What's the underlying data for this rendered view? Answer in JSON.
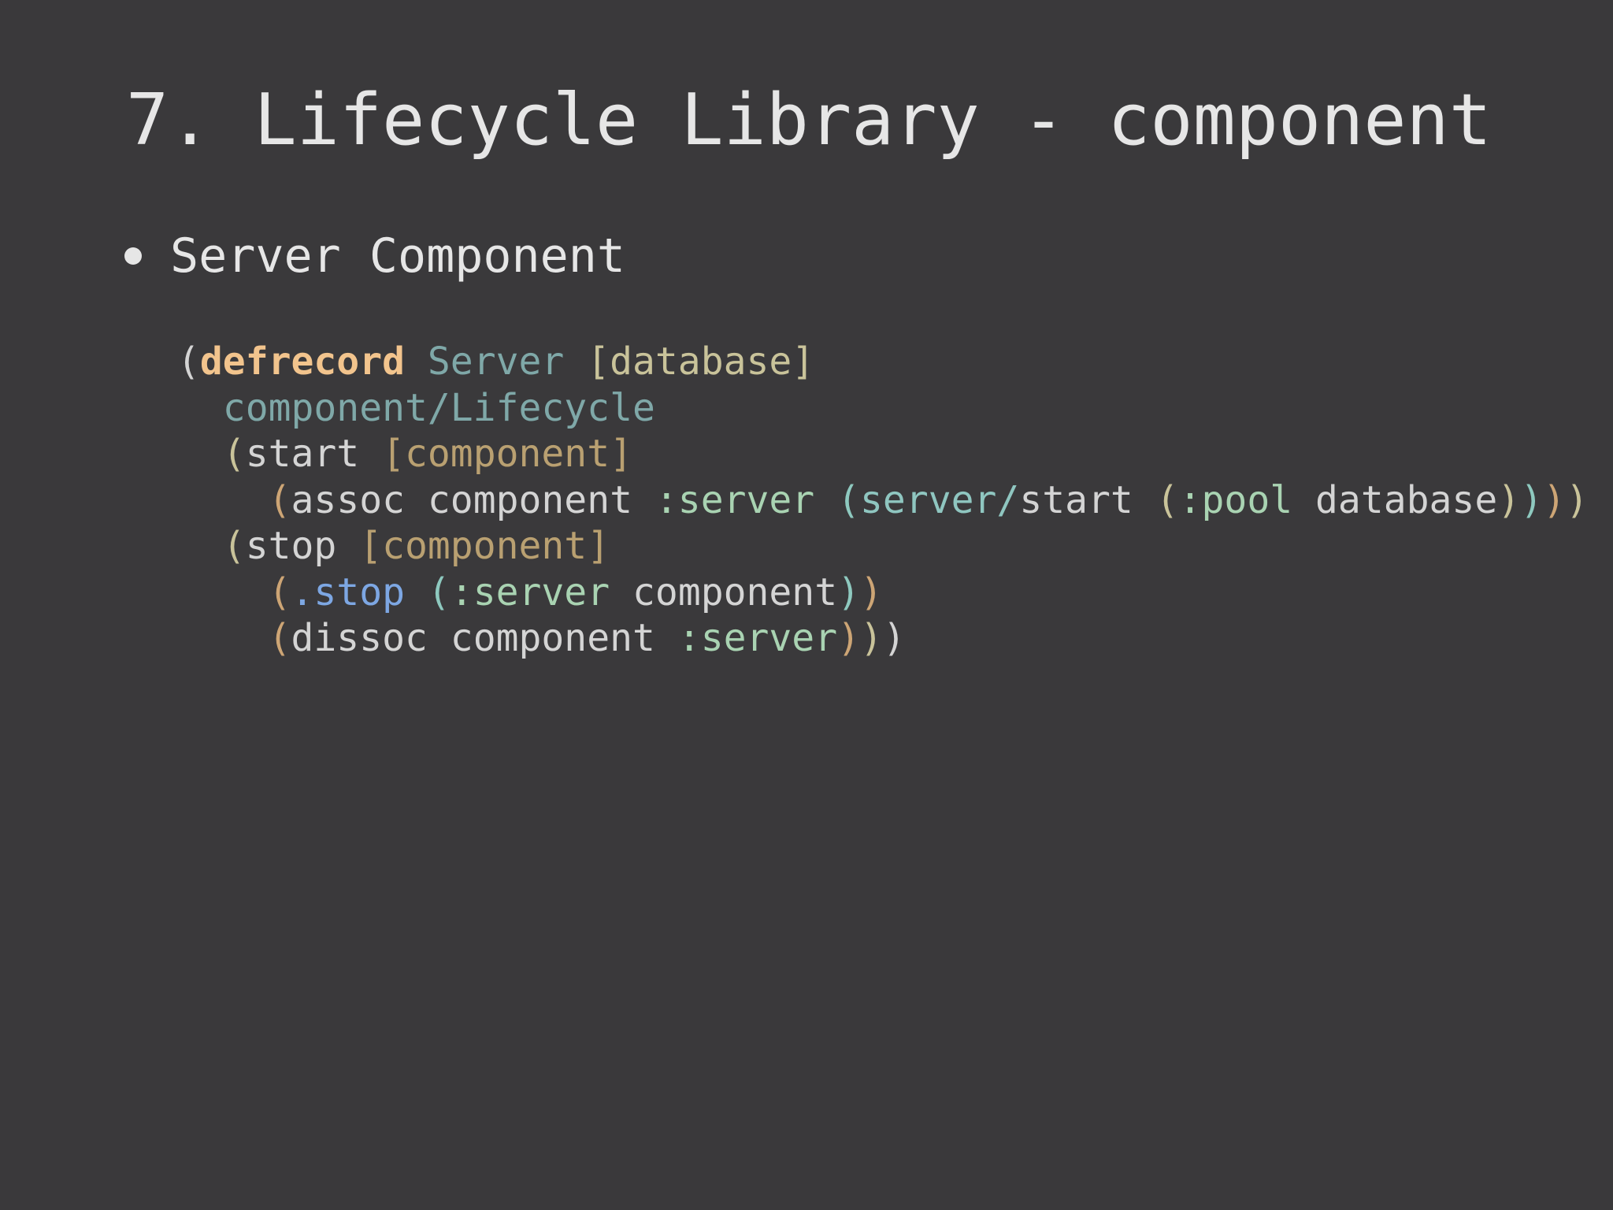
{
  "slide": {
    "title": "7. Lifecycle Library - component",
    "bullet": "Server Component"
  },
  "code": {
    "line1": {
      "open": "(",
      "keyword": "defrecord",
      "sp1": " ",
      "name": "Server",
      "sp2": " ",
      "params": "[database]"
    },
    "line2": {
      "indent": "  ",
      "protocol": "component/Lifecycle"
    },
    "line3": {
      "indent": "  ",
      "open": "(",
      "fn": "start",
      "sp": " ",
      "args": "[component]"
    },
    "line4": {
      "indent": "    ",
      "open": "(",
      "fn": "assoc",
      "sp1": " ",
      "target": "component",
      "sp2": " ",
      "key": ":server",
      "sp3": " ",
      "open2": "(",
      "ns": "server/",
      "fn2": "start",
      "sp4": " ",
      "open3": "(",
      "key2": ":pool",
      "sp5": " ",
      "arg": "database",
      "close3": ")",
      "close2": ")",
      "close1": ")",
      "close0": ")"
    },
    "line5": {
      "indent": "  ",
      "open": "(",
      "fn": "stop",
      "sp": " ",
      "args": "[component]"
    },
    "line6": {
      "indent": "    ",
      "open": "(",
      "method": ".stop",
      "sp1": " ",
      "open2": "(",
      "key": ":server",
      "sp2": " ",
      "target": "component",
      "close2": ")",
      "close1": ")"
    },
    "line7": {
      "indent": "    ",
      "open": "(",
      "fn": "dissoc",
      "sp1": " ",
      "target": "component",
      "sp2": " ",
      "key": ":server",
      "close1": ")",
      "close2": ")",
      "close3": ")"
    }
  },
  "colors": {
    "background": "#3a393b",
    "title_text": "#e6e6e6",
    "keyword": "#f2c48d",
    "type": "#7fa8a8",
    "keyword_arg": "#a9d3b2",
    "method": "#7da7e3"
  }
}
